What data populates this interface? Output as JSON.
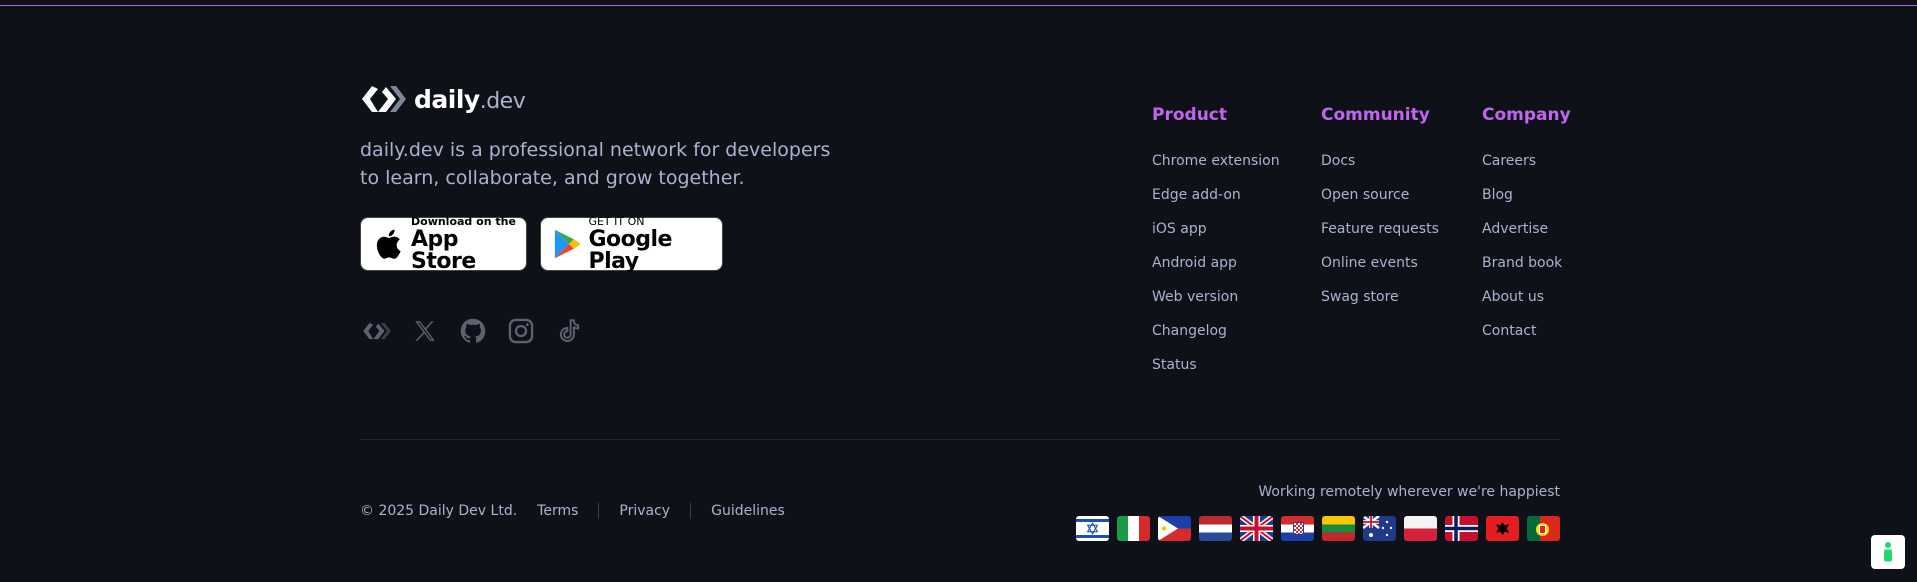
{
  "brand": {
    "name_main": "daily",
    "name_suffix": ".dev"
  },
  "tagline": "daily.dev is a professional network for developers to learn, collaborate, and grow together.",
  "stores": {
    "apple": {
      "small": "Download on the",
      "big": "App Store"
    },
    "google": {
      "small": "GET IT ON",
      "big": "Google Play"
    }
  },
  "socials": [
    "daily-dev-icon",
    "x-icon",
    "github-icon",
    "instagram-icon",
    "tiktok-icon"
  ],
  "columns": [
    {
      "title": "Product",
      "items": [
        "Chrome extension",
        "Edge add-on",
        "iOS app",
        "Android app",
        "Web version",
        "Changelog",
        "Status"
      ]
    },
    {
      "title": "Community",
      "items": [
        "Docs",
        "Open source",
        "Feature requests",
        "Online events",
        "Swag store"
      ]
    },
    {
      "title": "Company",
      "items": [
        "Careers",
        "Blog",
        "Advertise",
        "Brand book",
        "About us",
        "Contact"
      ]
    }
  ],
  "legal": {
    "copyright": "© 2025 Daily Dev Ltd.",
    "links": [
      "Terms",
      "Privacy",
      "Guidelines"
    ]
  },
  "remote_text": "Working remotely wherever we're happiest",
  "flags": [
    "israel",
    "italy",
    "philippines",
    "netherlands",
    "united-kingdom",
    "croatia",
    "lithuania",
    "australia",
    "poland",
    "norway",
    "albania",
    "portugal"
  ],
  "colors": {
    "background": "#0e1117",
    "accent": "#c464f0",
    "text": "#a8b3cf",
    "help": "#1ddc6f"
  }
}
